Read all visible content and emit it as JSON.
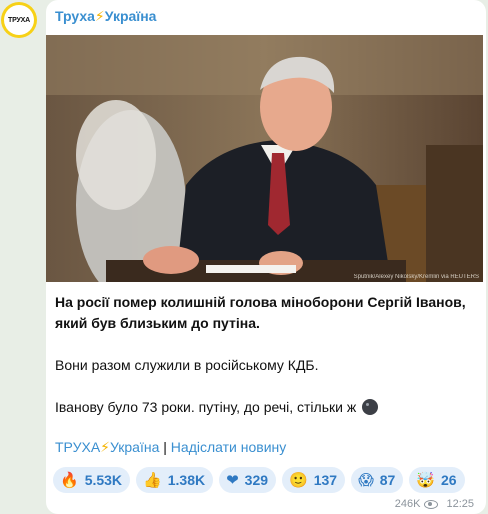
{
  "channel": {
    "avatar_text": "ТРУХА",
    "name": "Труха",
    "bolt": "⚡",
    "name_suffix": "Україна"
  },
  "photo": {
    "credit": "Sputnik/Alexey Nikolsky/Kremlin via REUTERS"
  },
  "post": {
    "line1": "На росії помер колишній голова міноборони Сергій Іванов,",
    "line2": "який був близьким до путіна.",
    "line3": "Вони разом служили в російському КДБ.",
    "line4": "Іванову було 73 роки. путіну, до речі, стільки ж",
    "line4_icon": "bomb-icon"
  },
  "footer": {
    "channel_link": "ТРУХА",
    "channel_link_bolt": "⚡",
    "channel_link_suffix": "Україна",
    "separator": "|",
    "submit_link": "Надіслати новину"
  },
  "reactions": [
    {
      "icon": "🔥",
      "icon_name": "fire-icon",
      "count": "5.53K"
    },
    {
      "icon": "👍",
      "icon_name": "thumbs-up-icon",
      "count": "1.38K"
    },
    {
      "icon": "❤",
      "icon_name": "heart-icon",
      "count": "329"
    },
    {
      "icon": "🙂",
      "icon_name": "smirk-face-icon",
      "count": "137"
    },
    {
      "icon": "😱",
      "icon_name": "scream-face-icon",
      "count": "87"
    },
    {
      "icon": "🤯",
      "icon_name": "exploding-head-icon",
      "count": "26"
    }
  ],
  "meta": {
    "views": "246K",
    "time": "12:25"
  },
  "colors": {
    "accent": "#3a8fd0",
    "avatar_ring": "#f7d117",
    "reaction_bg": "#e3eefa",
    "reaction_text": "#2f79c2",
    "page_bg": "#e8eee6"
  }
}
